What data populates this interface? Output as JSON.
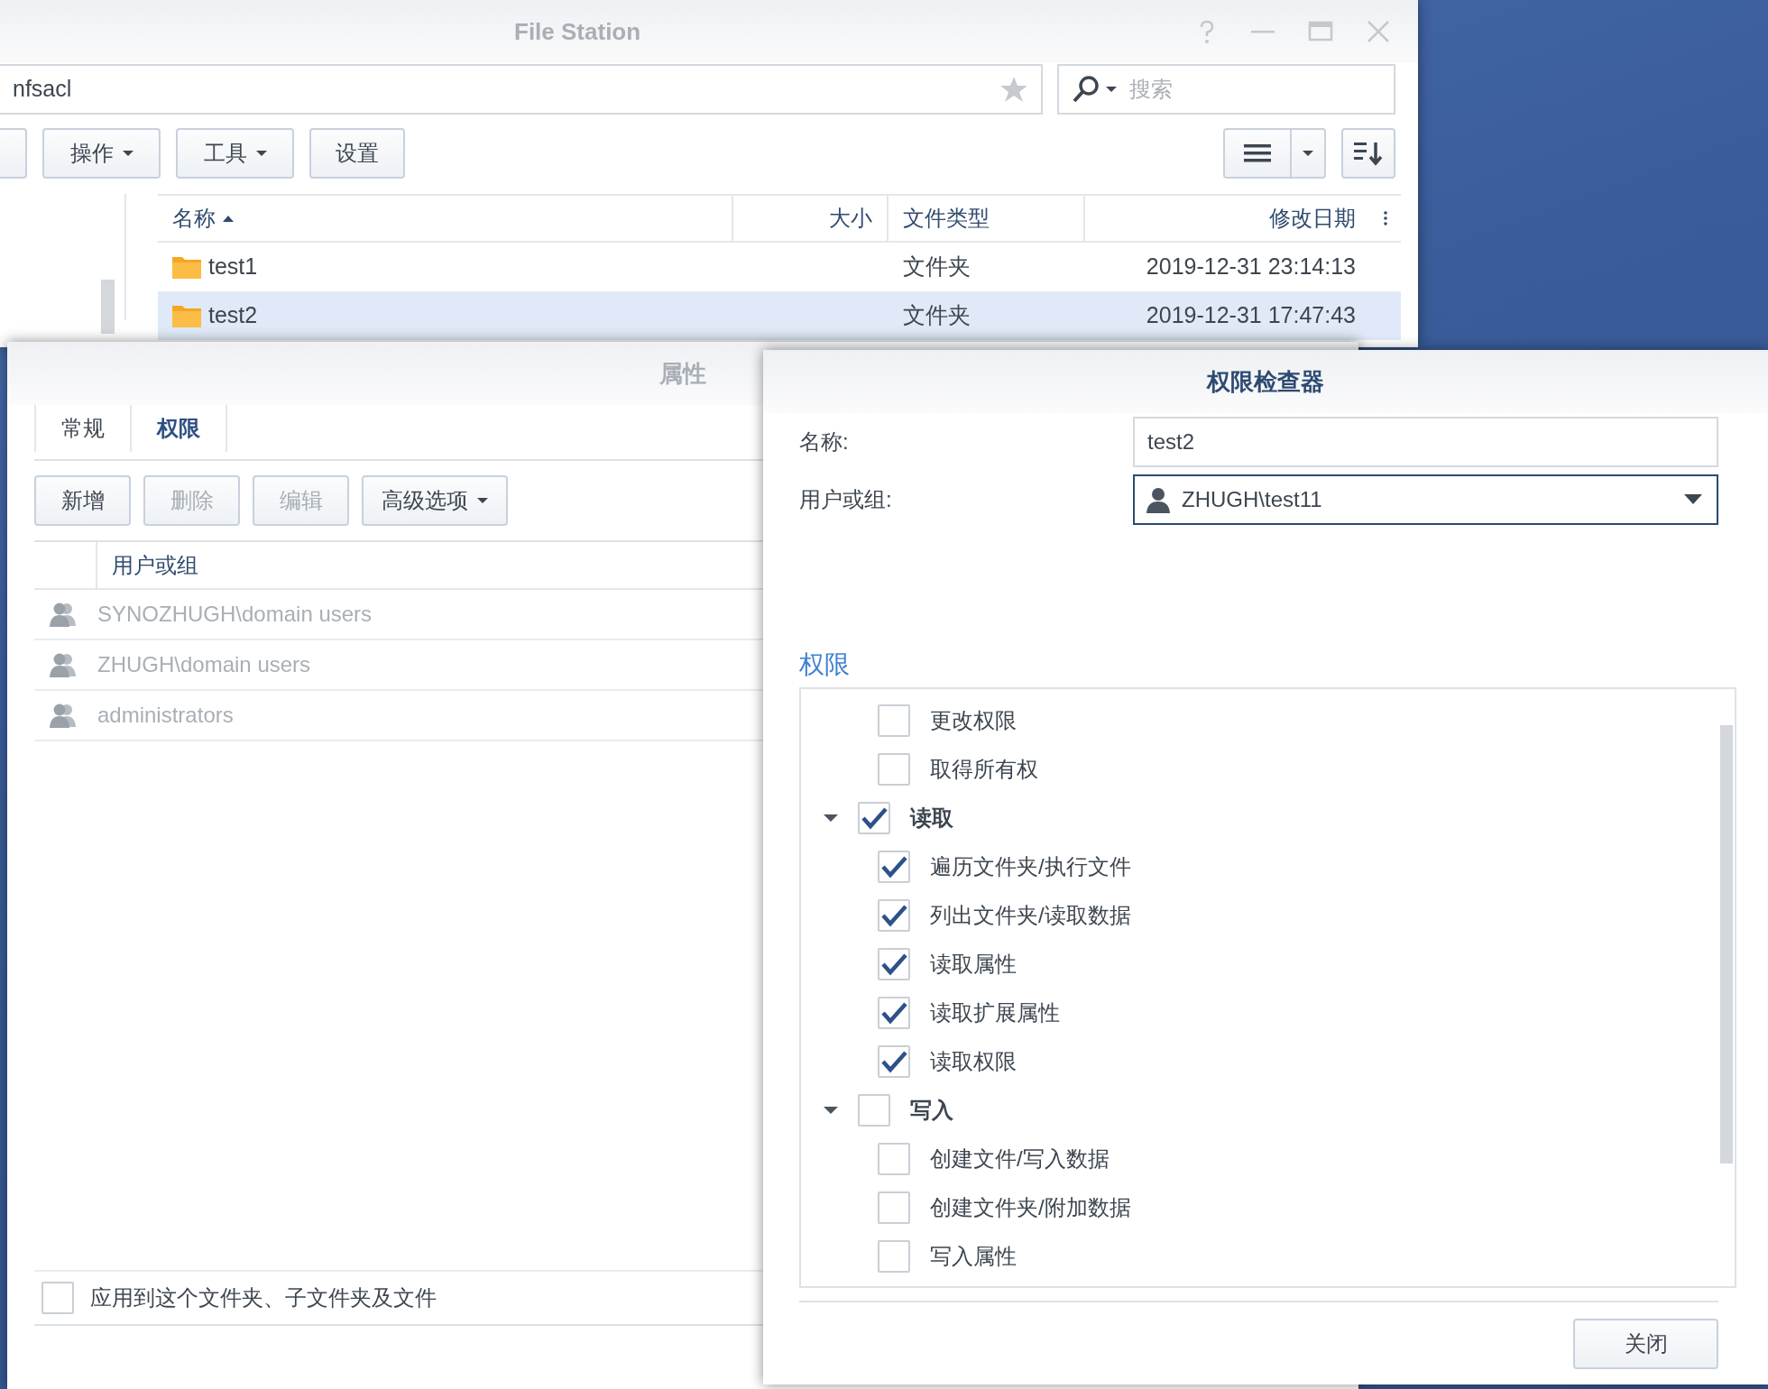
{
  "file_station": {
    "title": "File Station",
    "path": "nfsacl",
    "search": {
      "placeholder": "搜索"
    },
    "toolbar": [
      {
        "label": "操作",
        "dropdown": true
      },
      {
        "label": "工具",
        "dropdown": true
      },
      {
        "label": "设置",
        "dropdown": false
      }
    ],
    "table": {
      "columns": [
        {
          "label": "名称",
          "sorted": true
        },
        {
          "label": "大小",
          "sorted": false
        },
        {
          "label": "文件类型",
          "sorted": false
        },
        {
          "label": "修改日期",
          "sorted": false
        }
      ],
      "rows": [
        {
          "name": "test1",
          "type": "文件夹",
          "modified": "2019-12-31 23:14:13",
          "selected": false
        },
        {
          "name": "test2",
          "type": "文件夹",
          "modified": "2019-12-31 17:47:43",
          "selected": true
        }
      ]
    }
  },
  "properties": {
    "title": "属性",
    "tabs": [
      {
        "label": "常规",
        "selected": false
      },
      {
        "label": "权限",
        "selected": true
      }
    ],
    "buttons": [
      {
        "label": "新增",
        "disabled": false,
        "dropdown": false
      },
      {
        "label": "删除",
        "disabled": true,
        "dropdown": false
      },
      {
        "label": "编辑",
        "disabled": true,
        "dropdown": false
      },
      {
        "label": "高级选项",
        "disabled": false,
        "dropdown": true
      }
    ],
    "table": {
      "column": "用户或组",
      "rows": [
        {
          "name": "SYNOZHUGH\\domain users",
          "disabled": true
        },
        {
          "name": "ZHUGH\\domain users",
          "disabled": true
        },
        {
          "name": "administrators",
          "disabled": true
        }
      ]
    },
    "apply_checkbox": {
      "label": "应用到这个文件夹、子文件夹及文件",
      "checked": false
    }
  },
  "inspector": {
    "title": "权限检查器",
    "name_label": "名称:",
    "name_value": "test2",
    "user_label": "用户或组:",
    "user_value": "ZHUGH\\test11",
    "section": "权限",
    "permissions": [
      {
        "label": "更改权限",
        "checked": false
      },
      {
        "label": "取得所有权",
        "checked": false
      },
      {
        "label": "读取",
        "checked": true,
        "expanded": true,
        "children": [
          {
            "label": "遍历文件夹/执行文件",
            "checked": true
          },
          {
            "label": "列出文件夹/读取数据",
            "checked": true
          },
          {
            "label": "读取属性",
            "checked": true
          },
          {
            "label": "读取扩展属性",
            "checked": true
          },
          {
            "label": "读取权限",
            "checked": true
          }
        ]
      },
      {
        "label": "写入",
        "checked": false,
        "expanded": true,
        "children": [
          {
            "label": "创建文件/写入数据",
            "checked": false
          },
          {
            "label": "创建文件夹/附加数据",
            "checked": false
          },
          {
            "label": "写入属性",
            "checked": false
          }
        ]
      }
    ],
    "close": "关闭"
  }
}
